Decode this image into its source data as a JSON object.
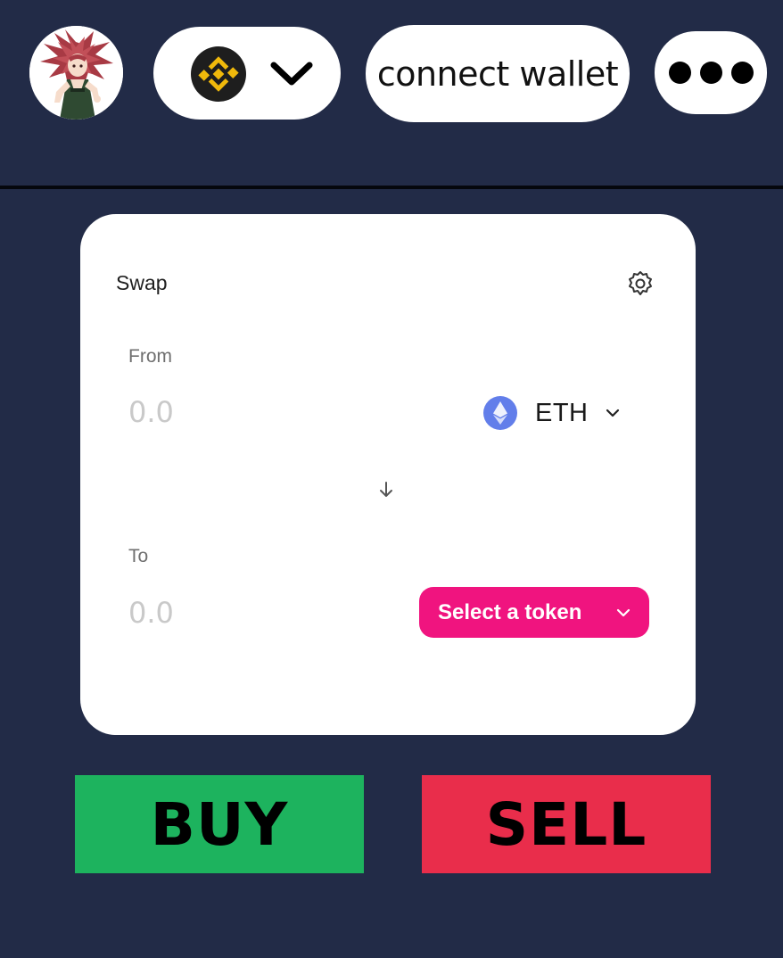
{
  "header": {
    "avatar_icon": "anime-character-avatar",
    "chain": {
      "icon": "binance-logo-icon",
      "brand_color": "#f0b90b",
      "dropdown_icon": "chevron-down-icon"
    },
    "connect_label": "connect wallet",
    "more_icon": "more-dots-icon"
  },
  "swap": {
    "title": "Swap",
    "settings_icon": "gear-icon",
    "from": {
      "label": "From",
      "amount_placeholder": "0.0",
      "token": "ETH",
      "token_icon": "eth-logo-icon"
    },
    "switch_icon": "arrow-down-icon",
    "to": {
      "label": "To",
      "amount_placeholder": "0.0",
      "select_label": "Select a token"
    },
    "accent_color": "#f0147f"
  },
  "actions": {
    "buy_label": "BUY",
    "buy_color": "#1db35e",
    "sell_label": "SELL",
    "sell_color": "#e92d4b"
  }
}
